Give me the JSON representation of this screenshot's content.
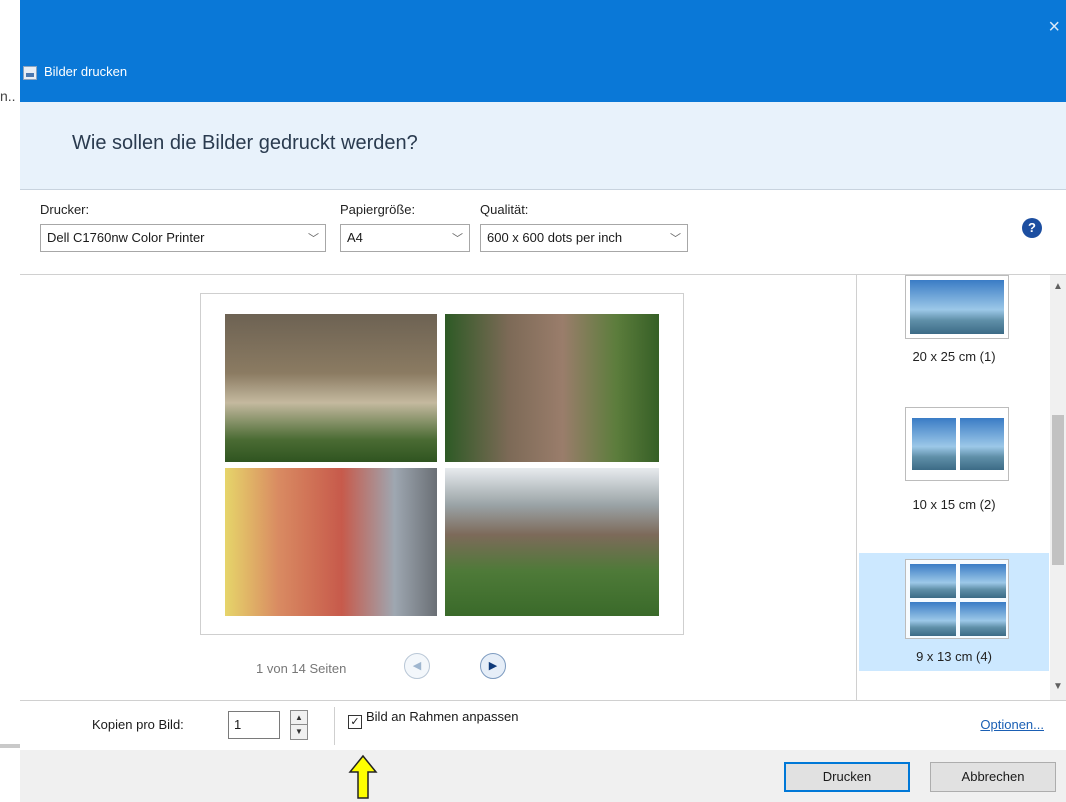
{
  "background_window": {
    "truncated_text": "n.."
  },
  "dialog": {
    "title": "Bilder drucken",
    "close_glyph": "×",
    "question": "Wie sollen die Bilder gedruckt werden?"
  },
  "settings": {
    "printer_label": "Drucker:",
    "printer_value": "Dell C1760nw Color Printer",
    "paper_label": "Papiergröße:",
    "paper_value": "A4",
    "quality_label": "Qualität:",
    "quality_value": "600 x 600 dots per inch",
    "help_glyph": "?"
  },
  "preview": {
    "page_indicator": "1 von 14 Seiten",
    "prev_glyph": "◀",
    "next_glyph": "▶"
  },
  "layouts": [
    {
      "label": "20 x 25 cm (1)",
      "selected": false
    },
    {
      "label": "10 x 15 cm (2)",
      "selected": false
    },
    {
      "label": "9 x 13 cm (4)",
      "selected": true
    }
  ],
  "bottom": {
    "copies_label": "Kopien pro Bild:",
    "copies_value": "1",
    "fit_label": "Bild an Rahmen anpassen",
    "fit_checked": true,
    "check_glyph": "✓",
    "options_link": "Optionen..."
  },
  "footer": {
    "print_label": "Drucken",
    "cancel_label": "Abbrechen"
  },
  "colors": {
    "titlebar": "#0a78d7",
    "header_band": "#e8f2fb",
    "selected_layout": "#cce8ff",
    "link": "#1a5fb4",
    "annotation_arrow": "#ffff00"
  }
}
